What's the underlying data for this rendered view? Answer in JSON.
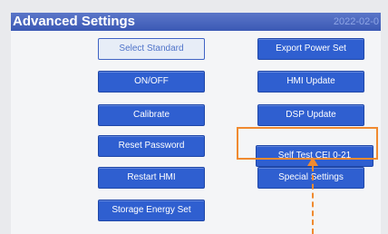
{
  "header": {
    "title": "Advanced Settings",
    "date": "2022-02-0"
  },
  "buttons": {
    "select_standard": "Select Standard",
    "on_off": "ON/OFF",
    "calibrate": "Calibrate",
    "reset_password": "Reset Password",
    "restart_hmi": "Restart HMI",
    "storage_energy_set": "Storage Energy Set",
    "export_power_set": "Export Power Set",
    "hmi_update": "HMI Update",
    "dsp_update": "DSP Update",
    "self_test": "Self Test CEI 0-21",
    "special_settings": "Special Settings"
  },
  "annotation": {
    "highlight_color": "#f08a30",
    "highlighted_button": "self_test"
  },
  "colors": {
    "button_blue": "#2f5fd0",
    "title_bar": "#3b59b5"
  }
}
